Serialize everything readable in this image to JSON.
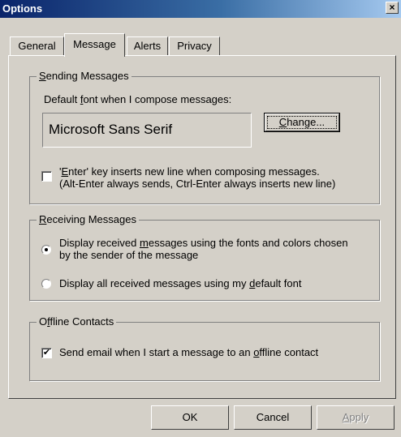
{
  "window": {
    "title": "Options",
    "close_glyph": "×"
  },
  "tabs": [
    {
      "label": "General",
      "active": false
    },
    {
      "label": "Message",
      "active": true
    },
    {
      "label": "Alerts",
      "active": false
    },
    {
      "label": "Privacy",
      "active": false
    }
  ],
  "sending": {
    "group_label_pre": "",
    "group_label_key": "S",
    "group_label_post": "ending Messages",
    "font_label_pre": "Default ",
    "font_label_key": "f",
    "font_label_post": "ont when I compose messages:",
    "font_value": "Microsoft Sans Serif",
    "change_button_pre": "",
    "change_button_key": "C",
    "change_button_post": "hange...",
    "enter_checkbox_checked": false,
    "enter_label_line1_pre": "'",
    "enter_label_line1_key": "E",
    "enter_label_line1_post": "nter' key inserts new line when composing messages.",
    "enter_label_line2": "(Alt-Enter always sends, Ctrl-Enter always inserts new line)"
  },
  "receiving": {
    "group_label_pre": "",
    "group_label_key": "R",
    "group_label_post": "eceiving Messages",
    "option1_selected": true,
    "option1_line1_pre": "Display received ",
    "option1_line1_key": "m",
    "option1_line1_post": "essages using the fonts and colors chosen",
    "option1_line2": "by the sender of the message",
    "option2_selected": false,
    "option2_pre": "Display all received messages using my ",
    "option2_key": "d",
    "option2_post": "efault font"
  },
  "offline": {
    "group_label_pre": "O",
    "group_label_key": "f",
    "group_label_post": "fline Contacts",
    "checkbox_checked": true,
    "check_glyph": "✔",
    "label_pre": "Send email when I start a message to an ",
    "label_key": "o",
    "label_post": "ffline contact"
  },
  "footer": {
    "ok_label": "OK",
    "cancel_label": "Cancel",
    "apply_pre": "",
    "apply_key": "A",
    "apply_post": "pply",
    "apply_enabled": false
  }
}
